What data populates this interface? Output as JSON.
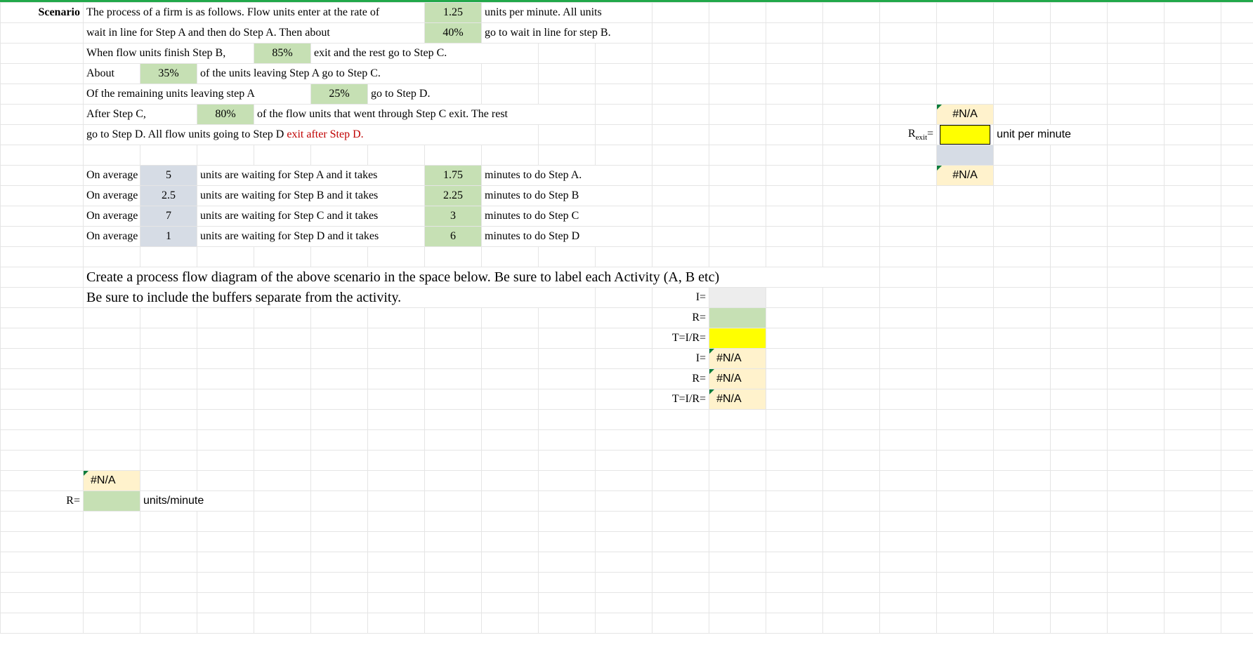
{
  "scenario_label": "Scenario",
  "r1": {
    "a": "The process of a firm is as follows.  Flow units enter at the rate of",
    "val": "1.25",
    "b": "units per minute.  All units"
  },
  "r2": {
    "a": "wait in line for Step A and then do Step A.  Then about",
    "val": "40%",
    "b": "go to wait in line for step B."
  },
  "r3": {
    "a": "When flow units finish Step B,",
    "val": "85%",
    "b": "exit and the rest go to Step C."
  },
  "r4": {
    "a": "About",
    "val": "35%",
    "b": "of the units leaving Step A go to Step C."
  },
  "r5": {
    "a": "Of the remaining units leaving step A",
    "val": "25%",
    "b": "go to Step D."
  },
  "r6": {
    "a": "After Step C,",
    "val": "80%",
    "b": "of the flow units that went through Step C exit.  The rest"
  },
  "r7": {
    "a": "go to Step D.  All flow units going to Step D ",
    "b": "exit after Step D."
  },
  "avg": {
    "pre": "On average",
    "A": {
      "wait": "5",
      "t1": "units are waiting for Step A and it takes",
      "dur": "1.75",
      "t2": "minutes to do Step A."
    },
    "B": {
      "wait": "2.5",
      "t1": "units are waiting for Step B and it takes",
      "dur": "2.25",
      "t2": "minutes to do Step B"
    },
    "C": {
      "wait": "7",
      "t1": "units are waiting for Step C and it takes",
      "dur": "3",
      "t2": "minutes to do Step C"
    },
    "D": {
      "wait": "1",
      "t1": "units are waiting for Step D and it takes",
      "dur": "6",
      "t2": "minutes to do Step D"
    }
  },
  "instr1": "Create a process flow diagram of the above scenario in the space below.   Be sure to label each Activity (A, B etc)",
  "instr2": "Be sure to include the buffers separate from the activity.",
  "side": {
    "na1": "#N/A",
    "rexit": "Rexit=",
    "rexit_unit": "unit per minute",
    "na2": "#N/A"
  },
  "calc": {
    "I": "I=",
    "R": "R=",
    "TIR": "T=I/R=",
    "na": "#N/A"
  },
  "bottom": {
    "na": "#N/A",
    "R": "R=",
    "unit": "units/minute"
  }
}
